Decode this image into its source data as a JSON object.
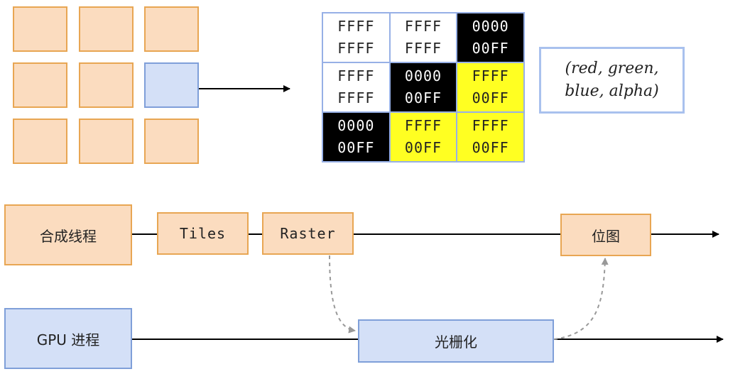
{
  "pixel_grid": [
    [
      {
        "top": "FFFF",
        "bottom": "FFFF",
        "color": "white"
      },
      {
        "top": "FFFF",
        "bottom": "FFFF",
        "color": "white"
      },
      {
        "top": "0000",
        "bottom": "00FF",
        "color": "black"
      }
    ],
    [
      {
        "top": "FFFF",
        "bottom": "FFFF",
        "color": "white"
      },
      {
        "top": "0000",
        "bottom": "00FF",
        "color": "black"
      },
      {
        "top": "FFFF",
        "bottom": "00FF",
        "color": "yellow"
      }
    ],
    [
      {
        "top": "0000",
        "bottom": "00FF",
        "color": "black"
      },
      {
        "top": "FFFF",
        "bottom": "00FF",
        "color": "yellow"
      },
      {
        "top": "FFFF",
        "bottom": "00FF",
        "color": "yellow"
      }
    ]
  ],
  "rgba_note": {
    "line1": "(red, green,",
    "line2": "blue, alpha)"
  },
  "nodes": {
    "compositor_thread": "合成线程",
    "tiles": "Tiles",
    "raster": "Raster",
    "bitmap": "位图",
    "gpu_process": "GPU 进程",
    "rasterization": "光栅化"
  },
  "colors": {
    "tile_fill": "#fbdcbf",
    "tile_border": "#e8a653",
    "selected_fill": "#d4e0f7",
    "selected_border": "#7f9fd9",
    "pixel_white": "#ffffff",
    "pixel_black": "#000000",
    "pixel_yellow": "#ffff22",
    "grid_border": "#97b0e6",
    "dashed_arrow": "#999999"
  }
}
